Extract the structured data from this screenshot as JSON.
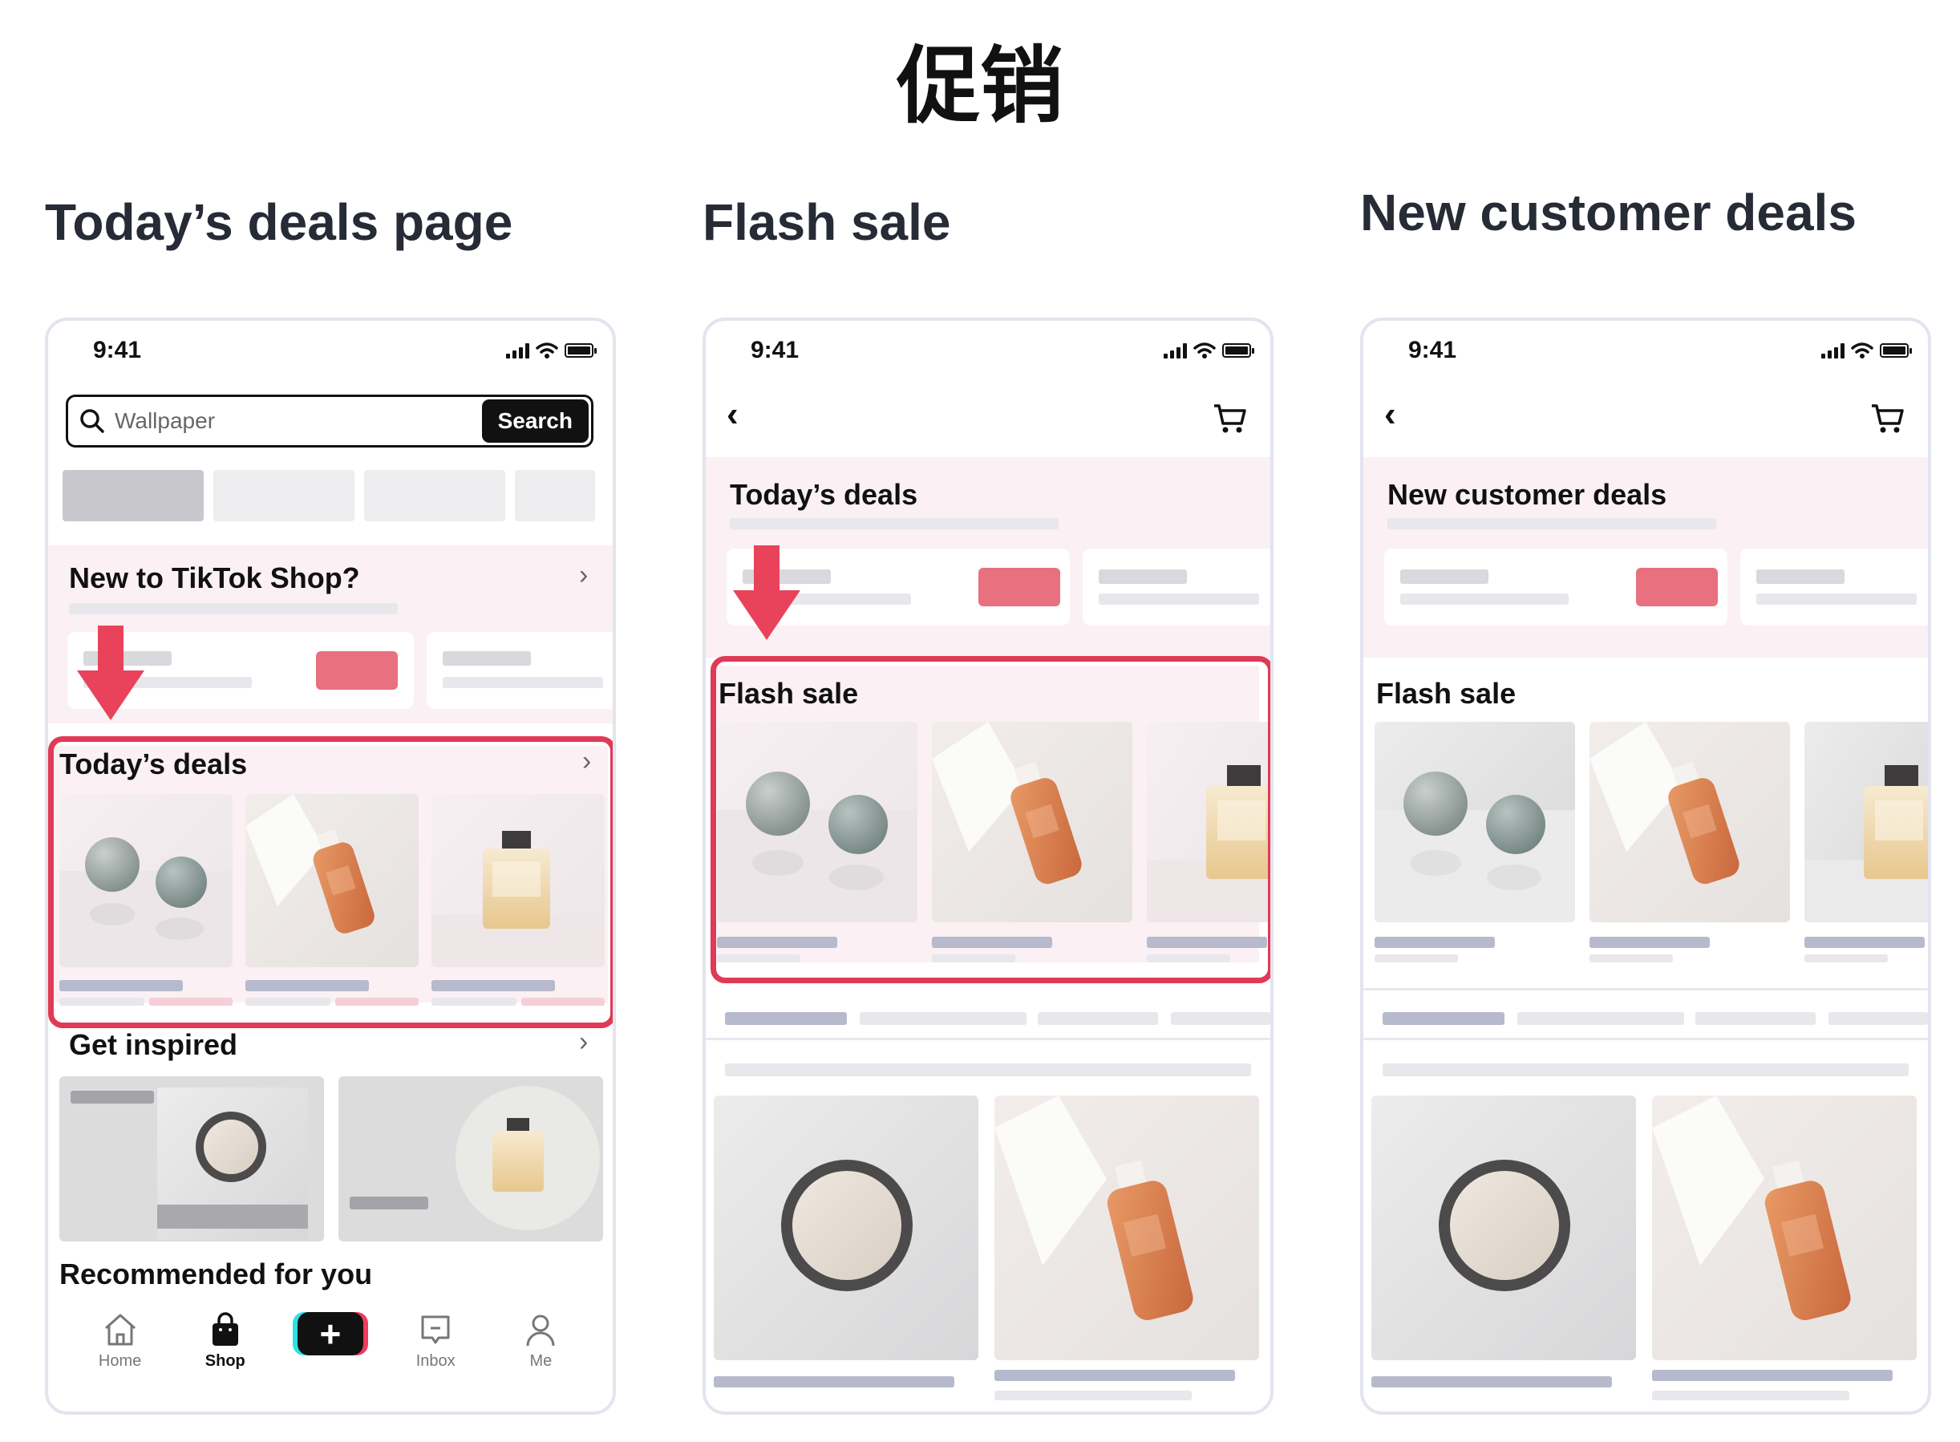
{
  "page": {
    "title": "促销"
  },
  "columns": [
    {
      "title": "Today’s deals page"
    },
    {
      "title": "Flash sale"
    },
    {
      "title": "New customer deals"
    }
  ],
  "phones": [
    {
      "status_time": "9:41",
      "search": {
        "placeholder": "Wallpaper",
        "button": "Search"
      },
      "sections": {
        "new_to_shop": "New to TikTok Shop?",
        "todays_deals": "Today’s deals",
        "get_inspired": "Get inspired",
        "recommended": "Recommended for you"
      },
      "nav": [
        "Home",
        "Shop",
        "",
        "Inbox",
        "Me"
      ]
    },
    {
      "status_time": "9:41",
      "banner_title": "Today’s deals",
      "section_title": "Flash sale"
    },
    {
      "status_time": "9:41",
      "banner_title": "New customer deals",
      "section_title": "Flash sale"
    }
  ],
  "colors": {
    "highlight": "#e03a56",
    "arrow": "#e8435a",
    "accent_button": "#e9707f",
    "banner_bg": "#fbf0f3"
  },
  "icons": [
    "search-icon",
    "signal-icon",
    "wifi-icon",
    "battery-icon",
    "back-chevron-icon",
    "cart-icon",
    "chevron-right-icon",
    "down-arrow-icon",
    "home-icon",
    "shop-bag-icon",
    "plus-icon",
    "inbox-icon",
    "profile-icon"
  ]
}
